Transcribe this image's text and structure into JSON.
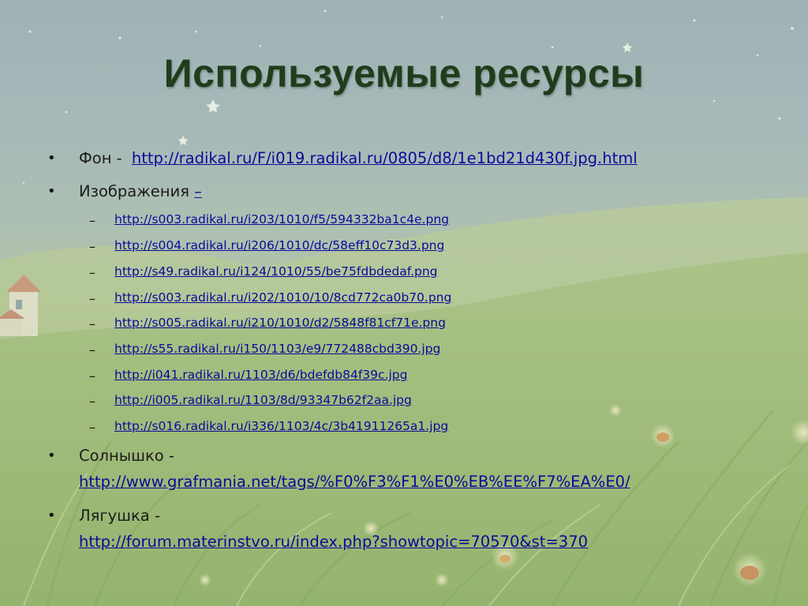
{
  "slide": {
    "title": "Используемые ресурсы",
    "bullets": [
      {
        "label": "Фон - ",
        "link": "http://radikal.ru/F/i019.radikal.ru/0805/d8/1e1bd21d430f.jpg.html"
      },
      {
        "label": "Изображения ",
        "link": "–",
        "subitems": [
          "http://s003.radikal.ru/i203/1010/f5/594332ba1c4e.png",
          "http://s004.radikal.ru/i206/1010/dc/58eff10c73d3.png",
          "http://s49.radikal.ru/i124/1010/55/be75fdbdedaf.png",
          "http://s003.radikal.ru/i202/1010/10/8cd772ca0b70.png",
          "http://s005.radikal.ru/i210/1010/d2/5848f81cf71e.png",
          "http://s55.radikal.ru/i150/1103/e9/772488cbd390.jpg",
          "http://i041.radikal.ru/1103/d6/bdefdb84f39c.jpg",
          "http://i005.radikal.ru/1103/8d/93347b62f2aa.jpg",
          "http://s016.radikal.ru/i336/1103/4c/3b41911265a1.jpg"
        ]
      },
      {
        "label": "Солнышко -",
        "link": "http://www.grafmania.net/tags/%F0%F3%F1%E0%EB%EE%F7%EA%E0/"
      },
      {
        "label": "Лягушка -",
        "link": "http://forum.materinstvo.ru/index.php?showtopic=70570&st=370"
      }
    ],
    "glyphs": {
      "bullet": "•",
      "dash": "–"
    }
  },
  "colors": {
    "title": "#1f3d1c",
    "link": "#0a0a9a",
    "text": "#1b1b1b"
  }
}
